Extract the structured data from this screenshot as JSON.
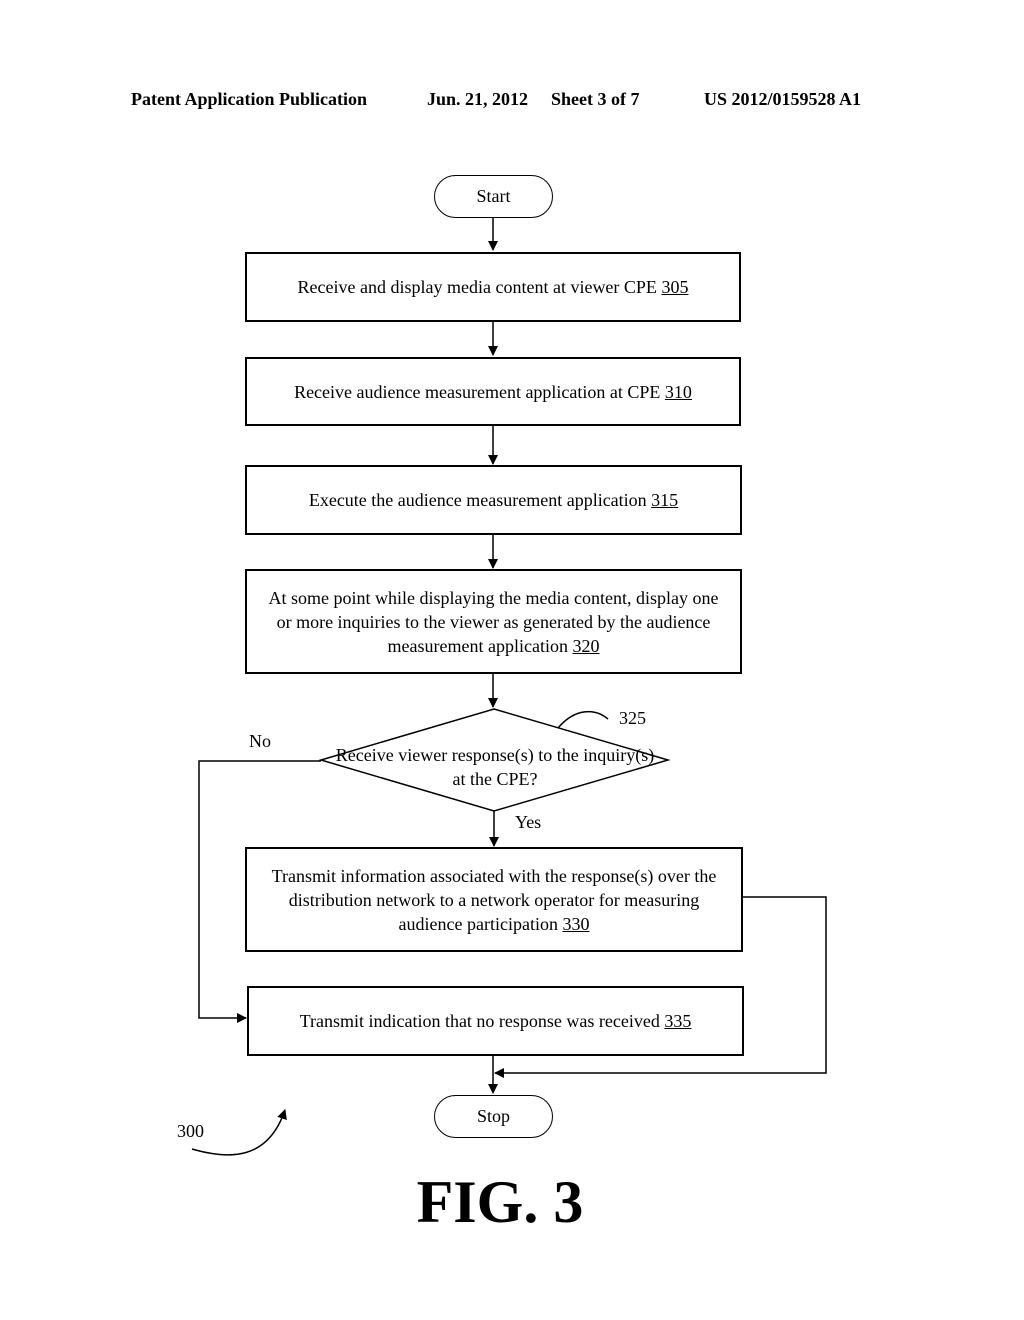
{
  "header": {
    "publication": "Patent Application Publication",
    "date": "Jun. 21, 2012",
    "sheet": "Sheet 3 of 7",
    "patent_number": "US 2012/0159528 A1"
  },
  "flowchart": {
    "start_label": "Start",
    "stop_label": "Stop",
    "steps": [
      {
        "text": "Receive and display media content at viewer CPE ",
        "ref": "305"
      },
      {
        "text": "Receive audience measurement application at CPE ",
        "ref": "310"
      },
      {
        "text": "Execute the audience measurement application ",
        "ref": "315"
      },
      {
        "text": "At some point while displaying the media content, display one or more inquiries to the viewer as generated by the audience measurement application ",
        "ref": "320"
      },
      {
        "text": "Transmit information associated with the response(s) over the distribution network to a network operator for measuring audience participation ",
        "ref": "330"
      },
      {
        "text": "Transmit indication that no response was received ",
        "ref": "335"
      }
    ],
    "decision": {
      "text": "Receive viewer response(s) to the inquiry(s) at the CPE?",
      "ref": "325",
      "yes_label": "Yes",
      "no_label": "No"
    },
    "figure_ref": "300"
  },
  "figure_label": "FIG. 3"
}
